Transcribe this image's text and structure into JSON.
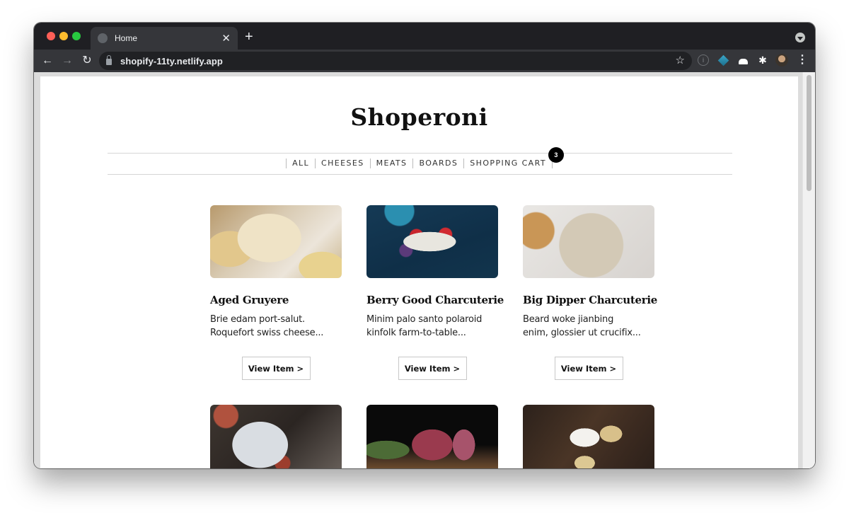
{
  "browser": {
    "tab_title": "Home",
    "tab_close": "✕",
    "new_tab": "+",
    "url": "shopify-11ty.netlify.app",
    "back": "←",
    "forward": "→",
    "reload": "↻",
    "star": "☆",
    "info": "i",
    "puzzle": "✱",
    "menu": "⋮"
  },
  "site": {
    "title": "Shoperoni",
    "nav": [
      {
        "label": "ALL"
      },
      {
        "label": "CHEESES"
      },
      {
        "label": "MEATS"
      },
      {
        "label": "BOARDS"
      },
      {
        "label": "SHOPPING CART",
        "badge": "3"
      }
    ]
  },
  "products": [
    {
      "title": "Aged Gruyere",
      "description": "Brie edam port-salut.\nRoquefort swiss cheese...",
      "button": "View Item >"
    },
    {
      "title": "Berry Good Charcuterie",
      "description": "Minim palo santo polaroid\nkinfolk farm-to-table...",
      "button": "View Item >"
    },
    {
      "title": "Big Dipper Charcuterie",
      "description": "Beard woke jianbing\nenim, glossier ut crucifix...",
      "button": "View Item >"
    },
    {
      "title": "",
      "description": "",
      "button": ""
    },
    {
      "title": "",
      "description": "",
      "button": ""
    },
    {
      "title": "",
      "description": "",
      "button": ""
    }
  ]
}
